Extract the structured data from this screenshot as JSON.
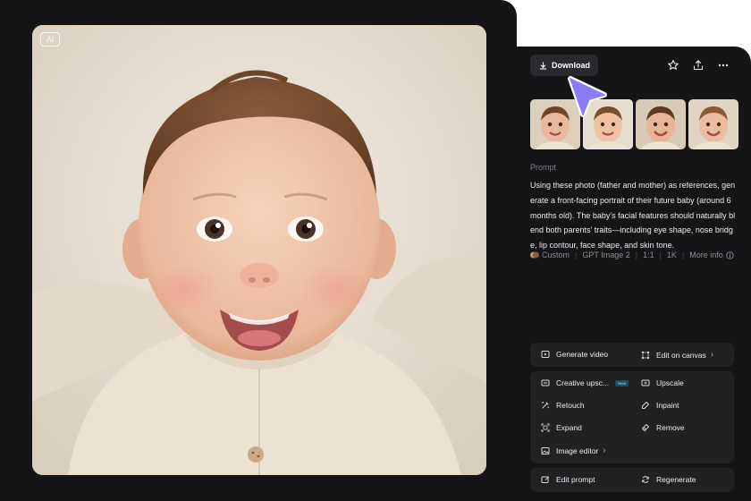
{
  "image_card": {
    "ai_badge": "AI"
  },
  "toolbar": {
    "download_label": "Download",
    "icons": [
      "download-icon",
      "star-icon",
      "share-icon",
      "more-icon"
    ]
  },
  "thumbnails": {
    "count": 4,
    "selected_index": 1
  },
  "prompt": {
    "label": "Prompt",
    "text": "Using these photo (father and mother) as references, generate a front-facing portrait of their future baby (around 6 months old). The baby's facial features should naturally blend both parents' traits—including eye shape, nose bridge, lip contour, face shape, and skin tone."
  },
  "meta": {
    "style": "Custom",
    "model": "GPT Image 2",
    "ratio": "1:1",
    "resolution": "1K",
    "more_info": "More info"
  },
  "actions": {
    "generate_video": "Generate video",
    "edit_on_canvas": "Edit on canvas",
    "creative_upscale": "Creative upsc...",
    "new_tag": "New",
    "upscale": "Upscale",
    "retouch": "Retouch",
    "inpaint": "Inpaint",
    "expand": "Expand",
    "remove": "Remove",
    "image_editor": "Image editor",
    "edit_prompt": "Edit prompt",
    "regenerate": "Regenerate"
  },
  "colors": {
    "panel_bg": "#151517",
    "group_bg": "#212124",
    "cursor_accent": "#8b7cf6"
  }
}
